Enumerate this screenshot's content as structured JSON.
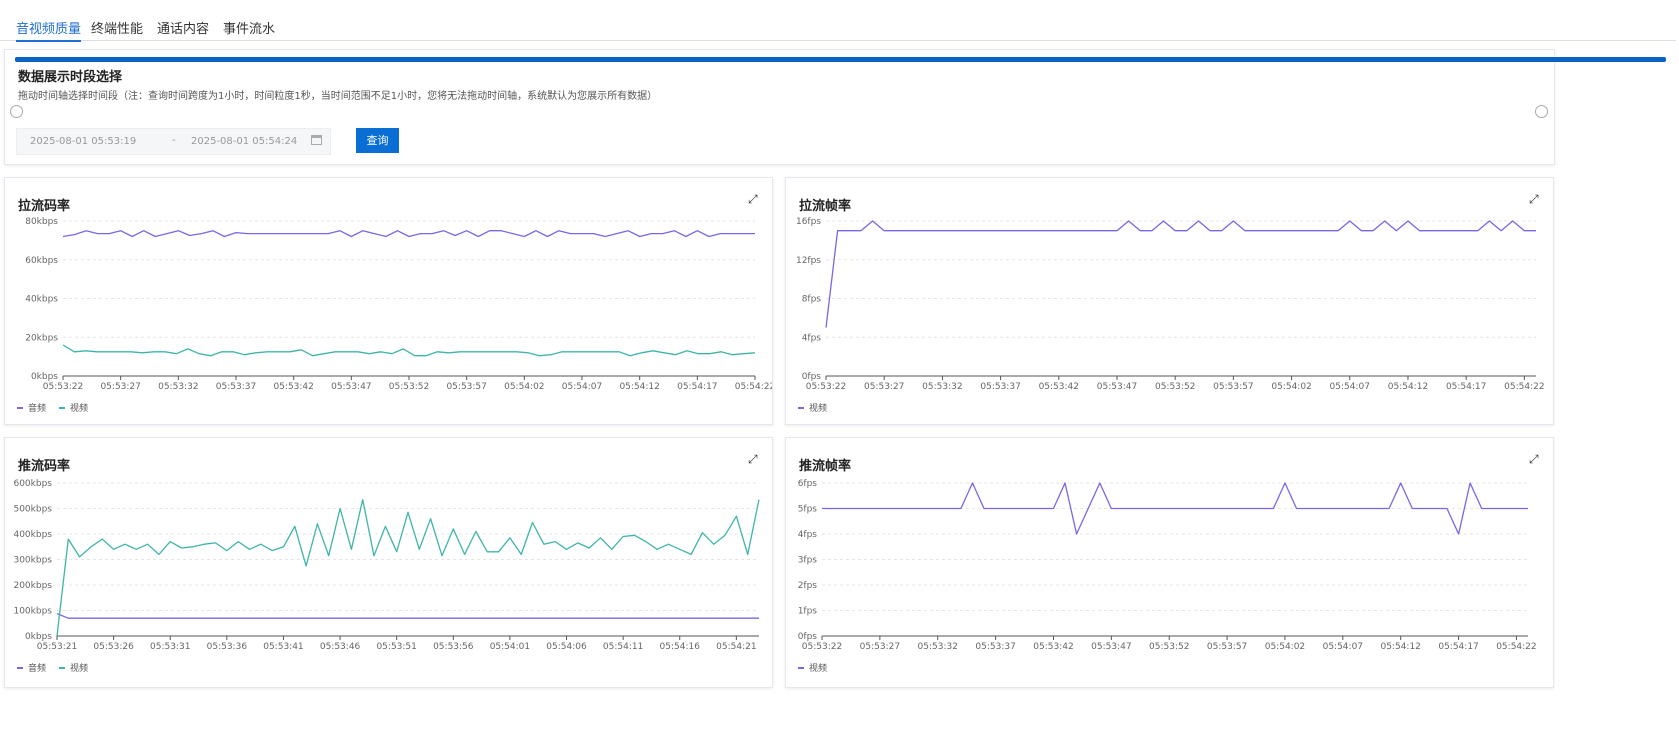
{
  "tabs": [
    {
      "label": "音视频质量"
    },
    {
      "label": "终端性能"
    },
    {
      "label": "通话内容"
    },
    {
      "label": "事件流水"
    }
  ],
  "selector": {
    "title": "数据展示时段选择",
    "description": "拖动时间轴选择时间段（注：查询时间跨度为1小时，时间粒度1秒，当时间范围不足1小时，您将无法拖动时间轴，系统默认为您展示所有数据）",
    "start": "2025-08-01 05:53:19",
    "separator": "-",
    "end": "2025-08-01 05:54:24",
    "query_label": "查询"
  },
  "colors": {
    "audio": "#7b66e6",
    "video": "#3fb5a9",
    "accent": "#0a62c4"
  },
  "icons": {
    "expand": "expand-icon",
    "calendar": "calendar-icon"
  },
  "chart_data": [
    {
      "id": "pull-bitrate",
      "type": "line",
      "title": "拉流码率",
      "yticks": [
        "0kbps",
        "20kbps",
        "40kbps",
        "60kbps",
        "80kbps"
      ],
      "ylim": [
        0,
        80
      ],
      "xticks": [
        "05:53:22",
        "05:53:27",
        "05:53:32",
        "05:53:37",
        "05:53:42",
        "05:53:47",
        "05:53:52",
        "05:53:57",
        "05:54:02",
        "05:54:07",
        "05:54:12",
        "05:54:17",
        "05:54:22"
      ],
      "x_start": 0,
      "x_step": 5,
      "x_end": 60,
      "series": [
        {
          "name": "音频",
          "color": "#7b66e6",
          "values": [
            72,
            73,
            75,
            73.5,
            73.5,
            75,
            72,
            75,
            72,
            73.5,
            75,
            72.5,
            73.5,
            75,
            72,
            74,
            73.5,
            73.5,
            73.5,
            73.5,
            73.5,
            73.5,
            73.5,
            73.5,
            75,
            72,
            75,
            73.5,
            72,
            75,
            72,
            73.5,
            73.5,
            75,
            72.5,
            75,
            72,
            75,
            75,
            73.5,
            72,
            75,
            72,
            75,
            73.5,
            73.5,
            73.5,
            72,
            73.5,
            75,
            72,
            73.5,
            73.5,
            75,
            72,
            75,
            72,
            73.5,
            73.5,
            73.5,
            73.5
          ]
        },
        {
          "name": "视频",
          "color": "#3fb5a9",
          "values": [
            16,
            12.5,
            13,
            12.5,
            12.5,
            12.5,
            12.5,
            12,
            12.5,
            12.5,
            11.5,
            14,
            11.5,
            10.5,
            12.5,
            12.5,
            11,
            12,
            12.5,
            12.5,
            12.5,
            13.5,
            10.5,
            11.5,
            12.5,
            12.5,
            12.5,
            11.5,
            12.5,
            11.5,
            14,
            10.5,
            10.5,
            12.5,
            12,
            12.5,
            12.5,
            12.5,
            12.5,
            12.5,
            12.5,
            12,
            10.5,
            11,
            12.5,
            12.5,
            12.5,
            12.5,
            12.5,
            12.5,
            10.5,
            12,
            13,
            12,
            11,
            13,
            11.5,
            11.5,
            12.5,
            11,
            11.5,
            12
          ]
        }
      ],
      "legend": [
        "音频",
        "视频"
      ]
    },
    {
      "id": "pull-framerate",
      "type": "line",
      "title": "拉流帧率",
      "yticks": [
        "0fps",
        "4fps",
        "8fps",
        "12fps",
        "16fps"
      ],
      "ylim": [
        0,
        16
      ],
      "xticks": [
        "05:53:22",
        "05:53:27",
        "05:53:32",
        "05:53:37",
        "05:53:42",
        "05:53:47",
        "05:53:52",
        "05:53:57",
        "05:54:02",
        "05:54:07",
        "05:54:12",
        "05:54:17",
        "05:54:22"
      ],
      "x_start": 0,
      "x_step": 5,
      "x_end": 61,
      "series": [
        {
          "name": "视频",
          "color": "#7b66e6",
          "values": [
            5,
            15,
            15,
            15,
            16,
            15,
            15,
            15,
            15,
            15,
            15,
            15,
            15,
            15,
            15,
            15,
            15,
            15,
            15,
            15,
            15,
            15,
            15,
            15,
            15,
            15,
            16,
            15,
            15,
            16,
            15,
            15,
            16,
            15,
            15,
            16,
            15,
            15,
            15,
            15,
            15,
            15,
            15,
            15,
            15,
            16,
            15,
            15,
            16,
            15,
            16,
            15,
            15,
            15,
            15,
            15,
            15,
            16,
            15,
            16,
            15,
            15
          ]
        }
      ],
      "legend": [
        "视频"
      ]
    },
    {
      "id": "push-bitrate",
      "type": "line",
      "title": "推流码率",
      "yticks": [
        "0kbps",
        "100kbps",
        "200kbps",
        "300kbps",
        "400kbps",
        "500kbps",
        "600kbps"
      ],
      "ylim": [
        0,
        600
      ],
      "xticks": [
        "05:53:21",
        "05:53:26",
        "05:53:31",
        "05:53:36",
        "05:53:41",
        "05:53:46",
        "05:53:51",
        "05:53:56",
        "05:54:01",
        "05:54:06",
        "05:54:11",
        "05:54:16",
        "05:54:21"
      ],
      "x_start": 0,
      "x_step": 5,
      "x_end": 62,
      "series": [
        {
          "name": "音频",
          "color": "#7b66e6",
          "values": [
            88,
            70,
            70,
            70,
            70,
            70,
            70,
            70,
            70,
            70,
            70,
            70,
            70,
            70,
            70,
            70,
            70,
            70,
            70,
            70,
            70,
            70,
            70,
            70,
            70,
            70,
            70,
            70,
            70,
            70,
            70,
            70,
            70,
            70,
            70,
            70,
            70,
            70,
            70,
            70,
            70,
            70,
            70,
            70,
            70,
            70,
            70,
            70,
            70,
            70,
            70,
            70,
            70,
            70,
            70,
            70,
            70,
            70,
            70,
            70,
            70,
            70,
            70
          ]
        },
        {
          "name": "视频",
          "color": "#3fb5a9",
          "values": [
            0,
            380,
            310,
            350,
            380,
            340,
            360,
            340,
            360,
            320,
            370,
            345,
            350,
            360,
            365,
            335,
            370,
            340,
            360,
            335,
            350,
            430,
            275,
            440,
            315,
            500,
            340,
            535,
            315,
            430,
            330,
            485,
            340,
            460,
            315,
            420,
            320,
            410,
            330,
            330,
            385,
            320,
            445,
            360,
            370,
            340,
            365,
            345,
            385,
            340,
            390,
            395,
            370,
            340,
            360,
            340,
            320,
            405,
            360,
            395,
            470,
            320,
            535
          ]
        }
      ],
      "legend": [
        "音频",
        "视频"
      ]
    },
    {
      "id": "push-framerate",
      "type": "line",
      "title": "推流帧率",
      "yticks": [
        "0fps",
        "1fps",
        "2fps",
        "3fps",
        "4fps",
        "5fps",
        "6fps"
      ],
      "ylim": [
        0,
        6
      ],
      "xticks": [
        "05:53:22",
        "05:53:27",
        "05:53:32",
        "05:53:37",
        "05:53:42",
        "05:53:47",
        "05:53:52",
        "05:53:57",
        "05:54:02",
        "05:54:07",
        "05:54:12",
        "05:54:17",
        "05:54:22"
      ],
      "x_start": 0,
      "x_step": 5,
      "x_end": 61,
      "series": [
        {
          "name": "视频",
          "color": "#7b66e6",
          "values": [
            5,
            5,
            5,
            5,
            5,
            5,
            5,
            5,
            5,
            5,
            5,
            5,
            5,
            6,
            5,
            5,
            5,
            5,
            5,
            5,
            5,
            6,
            4,
            5,
            6,
            5,
            5,
            5,
            5,
            5,
            5,
            5,
            5,
            5,
            5,
            5,
            5,
            5,
            5,
            5,
            6,
            5,
            5,
            5,
            5,
            5,
            5,
            5,
            5,
            5,
            6,
            5,
            5,
            5,
            5,
            4,
            6,
            5,
            5,
            5,
            5,
            5
          ]
        }
      ],
      "legend": [
        "视频"
      ]
    }
  ]
}
